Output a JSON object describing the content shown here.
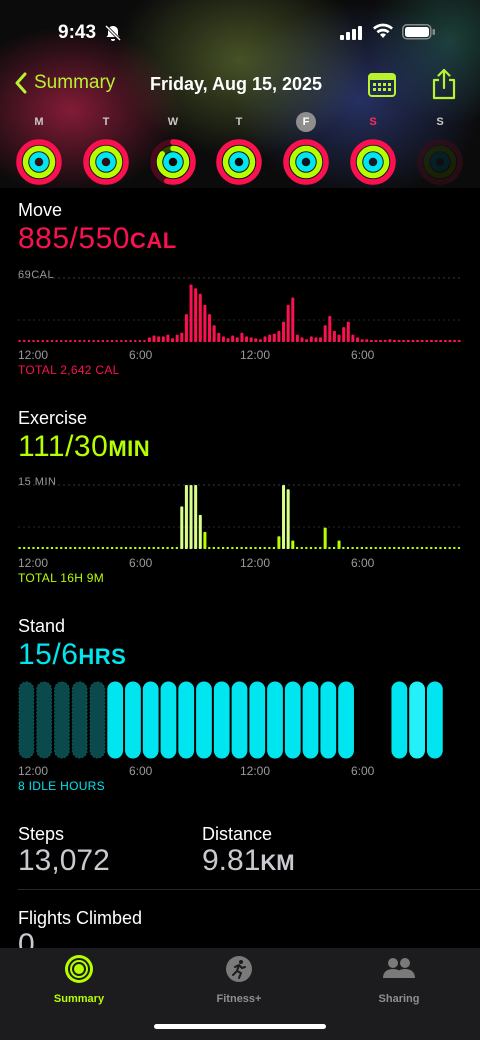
{
  "status_bar": {
    "time": "9:43"
  },
  "nav": {
    "back_label": "Summary",
    "title": "Friday, Aug 15, 2025"
  },
  "week": [
    {
      "label": "M",
      "today": false,
      "move": 1.0,
      "exercise": 1.0,
      "stand": 1.0
    },
    {
      "label": "T",
      "today": false,
      "move": 1.0,
      "exercise": 1.0,
      "stand": 1.0
    },
    {
      "label": "W",
      "today": false,
      "move": 0.55,
      "exercise": 0.85,
      "stand": 1.0
    },
    {
      "label": "T",
      "today": false,
      "move": 1.0,
      "exercise": 1.0,
      "stand": 1.0
    },
    {
      "label": "F",
      "today": true,
      "move": 1.0,
      "exercise": 1.0,
      "stand": 1.0
    },
    {
      "label": "S",
      "today": false,
      "sunday_color": true,
      "move": 1.0,
      "exercise": 1.0,
      "stand": 1.0
    },
    {
      "label": "S",
      "today": false,
      "dimmed": true,
      "move": 0.0,
      "exercise": 0.0,
      "stand": 0.0
    }
  ],
  "move": {
    "title": "Move",
    "value": "885/550",
    "unit": "CAL",
    "max_label": "69CAL",
    "ticks": [
      "12:00",
      "6:00",
      "12:00",
      "6:00"
    ],
    "total": "TOTAL 2,642 CAL",
    "color": "#fa114f",
    "max": 69,
    "bars": [
      0,
      0,
      0,
      0,
      0,
      0,
      0,
      0,
      0,
      0,
      0,
      0,
      0,
      0,
      0,
      0,
      0,
      0,
      0,
      0,
      0,
      0,
      0,
      0,
      0,
      0,
      0,
      0,
      5,
      7,
      6,
      6,
      8,
      4,
      8,
      10,
      30,
      62,
      58,
      52,
      40,
      30,
      18,
      10,
      6,
      4,
      7,
      5,
      10,
      6,
      5,
      4,
      3,
      6,
      8,
      9,
      12,
      22,
      40,
      48,
      8,
      5,
      3,
      6,
      5,
      5,
      18,
      28,
      12,
      8,
      16,
      22,
      8,
      5,
      3,
      3,
      2,
      2,
      2,
      2,
      3,
      2,
      2,
      1,
      2,
      1,
      1,
      1,
      1,
      1,
      1,
      1,
      1,
      1,
      1,
      1
    ]
  },
  "exercise": {
    "title": "Exercise",
    "value": "111/30",
    "unit": "MIN",
    "max_label": "15 MIN",
    "ticks": [
      "12:00",
      "6:00",
      "12:00",
      "6:00"
    ],
    "total": "TOTAL 16H 9M",
    "color": "#b6ff00",
    "max": 15,
    "bars": [
      0,
      0,
      0,
      0,
      0,
      0,
      0,
      0,
      0,
      0,
      0,
      0,
      0,
      0,
      0,
      0,
      0,
      0,
      0,
      0,
      0,
      0,
      0,
      0,
      0,
      0,
      0,
      0,
      0,
      0,
      0,
      0,
      0,
      0,
      0,
      0,
      0,
      0,
      0,
      0,
      0,
      0,
      0,
      0,
      0,
      0,
      0,
      0,
      0,
      0,
      0,
      0,
      0,
      0,
      0,
      0,
      0,
      0,
      0,
      0,
      0,
      0,
      0,
      0,
      0,
      0,
      0,
      0,
      0,
      0,
      0,
      0,
      0,
      0,
      0,
      0,
      0,
      0,
      0,
      0,
      0,
      0,
      0,
      0,
      0,
      0,
      0,
      0,
      0,
      0,
      0,
      0,
      0,
      0,
      0,
      0
    ],
    "highlight_bars": [
      {
        "index": 35,
        "value": 10
      },
      {
        "index": 36,
        "value": 15
      },
      {
        "index": 37,
        "value": 15
      },
      {
        "index": 38,
        "value": 15
      },
      {
        "index": 39,
        "value": 8
      },
      {
        "index": 40,
        "value": 4
      },
      {
        "index": 56,
        "value": 3
      },
      {
        "index": 57,
        "value": 15
      },
      {
        "index": 58,
        "value": 14
      },
      {
        "index": 59,
        "value": 2
      },
      {
        "index": 66,
        "value": 5
      },
      {
        "index": 69,
        "value": 2
      }
    ]
  },
  "stand": {
    "title": "Stand",
    "value": "15/6",
    "unit": "HRS",
    "ticks": [
      "12:00",
      "6:00",
      "12:00",
      "6:00"
    ],
    "idle": "8 IDLE HOURS",
    "color": "#00e5ef",
    "hours": [
      0,
      0,
      0,
      0,
      0,
      1,
      1,
      1,
      1,
      1,
      1,
      1,
      1,
      1,
      1,
      1,
      1,
      1,
      1,
      0,
      0,
      1,
      2,
      1,
      0
    ]
  },
  "steps": {
    "label": "Steps",
    "value": "13,072"
  },
  "distance": {
    "label": "Distance",
    "value": "9.81",
    "unit": "KM"
  },
  "flights": {
    "label": "Flights Climbed",
    "value": "0"
  },
  "tabs": [
    {
      "label": "Summary",
      "active": true
    },
    {
      "label": "Fitness+",
      "active": false
    },
    {
      "label": "Sharing",
      "active": false
    }
  ]
}
